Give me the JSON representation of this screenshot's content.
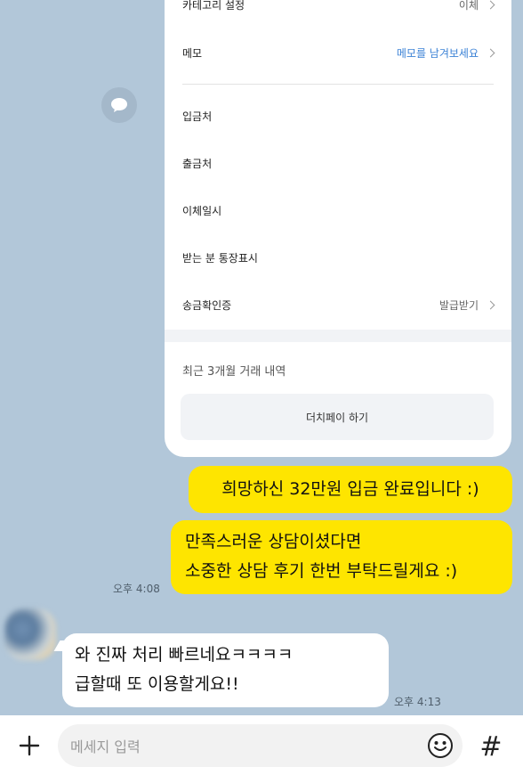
{
  "card": {
    "rows": [
      {
        "label": "카테고리 설정",
        "value": "이체"
      },
      {
        "label": "메모",
        "value": "메모를 남겨보세요"
      },
      {
        "label": "입금처",
        "value": ""
      },
      {
        "label": "출금처",
        "value": ""
      },
      {
        "label": "이체일시",
        "value": ""
      },
      {
        "label": "받는 분 통장표시",
        "value": ""
      },
      {
        "label": "송금확인증",
        "value": "발급받기"
      }
    ],
    "recent_label": "최근 3개월 거래 내역",
    "dutch_pay_label": "더치페이 하기"
  },
  "messages": {
    "m1": "희망하신 32만원 입금 완료입니다 :)",
    "m2_line1": "만족스러운 상담이셨다면",
    "m2_line2": "소중한 상담 후기 한번 부탁드릴게요 :)",
    "m2_time": "오후 4:08",
    "m3_line1": "와 진짜 처리 빠르네요ㅋㅋㅋㅋ",
    "m3_line2": "급할때 또 이용할게요!!",
    "m3_time": "오후 4:13"
  },
  "input": {
    "placeholder": "메세지 입력"
  },
  "icons": {
    "plus": "plus-icon",
    "emoji": "emoji-icon",
    "hash": "hash-icon",
    "chat": "chat-bubble-icon"
  },
  "colors": {
    "background": "#b2c7d9",
    "my_bubble": "#fee500",
    "memo_link": "#3b82d6"
  }
}
